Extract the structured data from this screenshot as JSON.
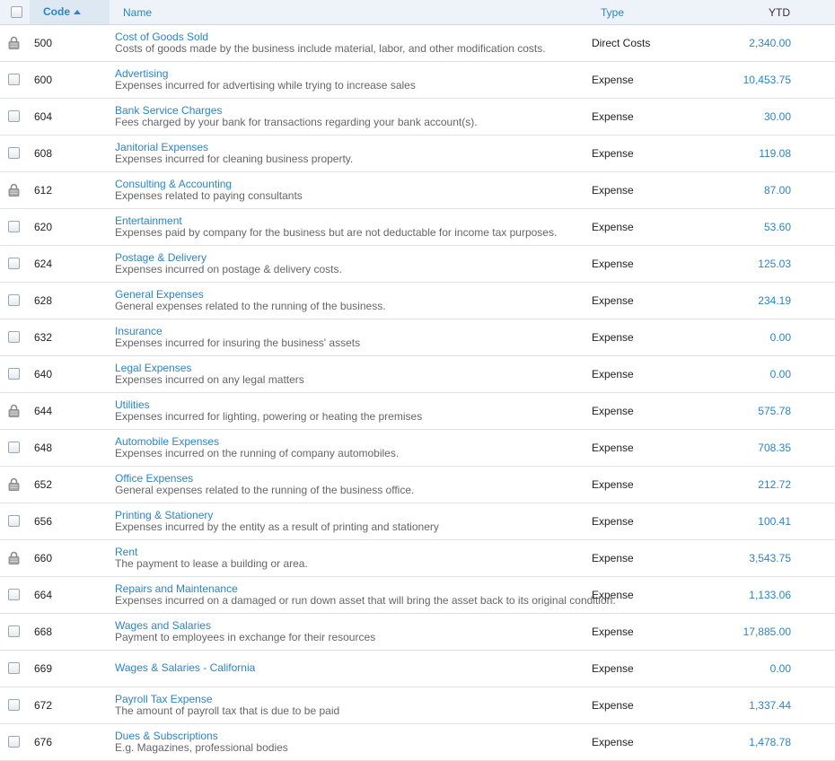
{
  "header": {
    "code": "Code",
    "name": "Name",
    "type": "Type",
    "ytd": "YTD"
  },
  "rows": [
    {
      "code": "500",
      "name": "Cost of Goods Sold",
      "desc": "Costs of goods made by the business include material, labor, and other modification costs.",
      "type": "Direct Costs",
      "ytd": "2,340.00",
      "locked": true
    },
    {
      "code": "600",
      "name": "Advertising",
      "desc": "Expenses incurred for advertising while trying to increase sales",
      "type": "Expense",
      "ytd": "10,453.75",
      "locked": false
    },
    {
      "code": "604",
      "name": "Bank Service Charges",
      "desc": "Fees charged by your bank for transactions regarding your bank account(s).",
      "type": "Expense",
      "ytd": "30.00",
      "locked": false
    },
    {
      "code": "608",
      "name": "Janitorial Expenses",
      "desc": "Expenses incurred for cleaning business property.",
      "type": "Expense",
      "ytd": "119.08",
      "locked": false
    },
    {
      "code": "612",
      "name": "Consulting & Accounting",
      "desc": "Expenses related to paying consultants",
      "type": "Expense",
      "ytd": "87.00",
      "locked": true
    },
    {
      "code": "620",
      "name": "Entertainment",
      "desc": "Expenses paid by company for the business but are not deductable for income tax purposes.",
      "type": "Expense",
      "ytd": "53.60",
      "locked": false
    },
    {
      "code": "624",
      "name": "Postage & Delivery",
      "desc": "Expenses incurred on postage & delivery costs.",
      "type": "Expense",
      "ytd": "125.03",
      "locked": false
    },
    {
      "code": "628",
      "name": "General Expenses",
      "desc": "General expenses related to the running of the business.",
      "type": "Expense",
      "ytd": "234.19",
      "locked": false
    },
    {
      "code": "632",
      "name": "Insurance",
      "desc": "Expenses incurred for insuring the business' assets",
      "type": "Expense",
      "ytd": "0.00",
      "locked": false
    },
    {
      "code": "640",
      "name": "Legal Expenses",
      "desc": "Expenses incurred on any legal matters",
      "type": "Expense",
      "ytd": "0.00",
      "locked": false
    },
    {
      "code": "644",
      "name": "Utilities",
      "desc": "Expenses incurred for lighting, powering or heating the premises",
      "type": "Expense",
      "ytd": "575.78",
      "locked": true
    },
    {
      "code": "648",
      "name": "Automobile Expenses",
      "desc": "Expenses incurred on the running of company automobiles.",
      "type": "Expense",
      "ytd": "708.35",
      "locked": false
    },
    {
      "code": "652",
      "name": "Office Expenses",
      "desc": "General expenses related to the running of the business office.",
      "type": "Expense",
      "ytd": "212.72",
      "locked": true
    },
    {
      "code": "656",
      "name": "Printing & Stationery",
      "desc": "Expenses incurred by the entity as a result of printing and stationery",
      "type": "Expense",
      "ytd": "100.41",
      "locked": false
    },
    {
      "code": "660",
      "name": "Rent",
      "desc": "The payment to lease a building or area.",
      "type": "Expense",
      "ytd": "3,543.75",
      "locked": true
    },
    {
      "code": "664",
      "name": "Repairs and Maintenance",
      "desc": "Expenses incurred on a damaged or run down asset that will bring the asset back to its original condition.",
      "type": "Expense",
      "ytd": "1,133.06",
      "locked": false
    },
    {
      "code": "668",
      "name": "Wages and Salaries",
      "desc": "Payment to employees in exchange for their resources",
      "type": "Expense",
      "ytd": "17,885.00",
      "locked": false
    },
    {
      "code": "669",
      "name": "Wages & Salaries - California",
      "desc": "",
      "type": "Expense",
      "ytd": "0.00",
      "locked": false
    },
    {
      "code": "672",
      "name": "Payroll Tax Expense",
      "desc": "The amount of payroll tax that is due to be paid",
      "type": "Expense",
      "ytd": "1,337.44",
      "locked": false
    },
    {
      "code": "676",
      "name": "Dues & Subscriptions",
      "desc": "E.g. Magazines, professional bodies",
      "type": "Expense",
      "ytd": "1,478.78",
      "locked": false
    }
  ]
}
